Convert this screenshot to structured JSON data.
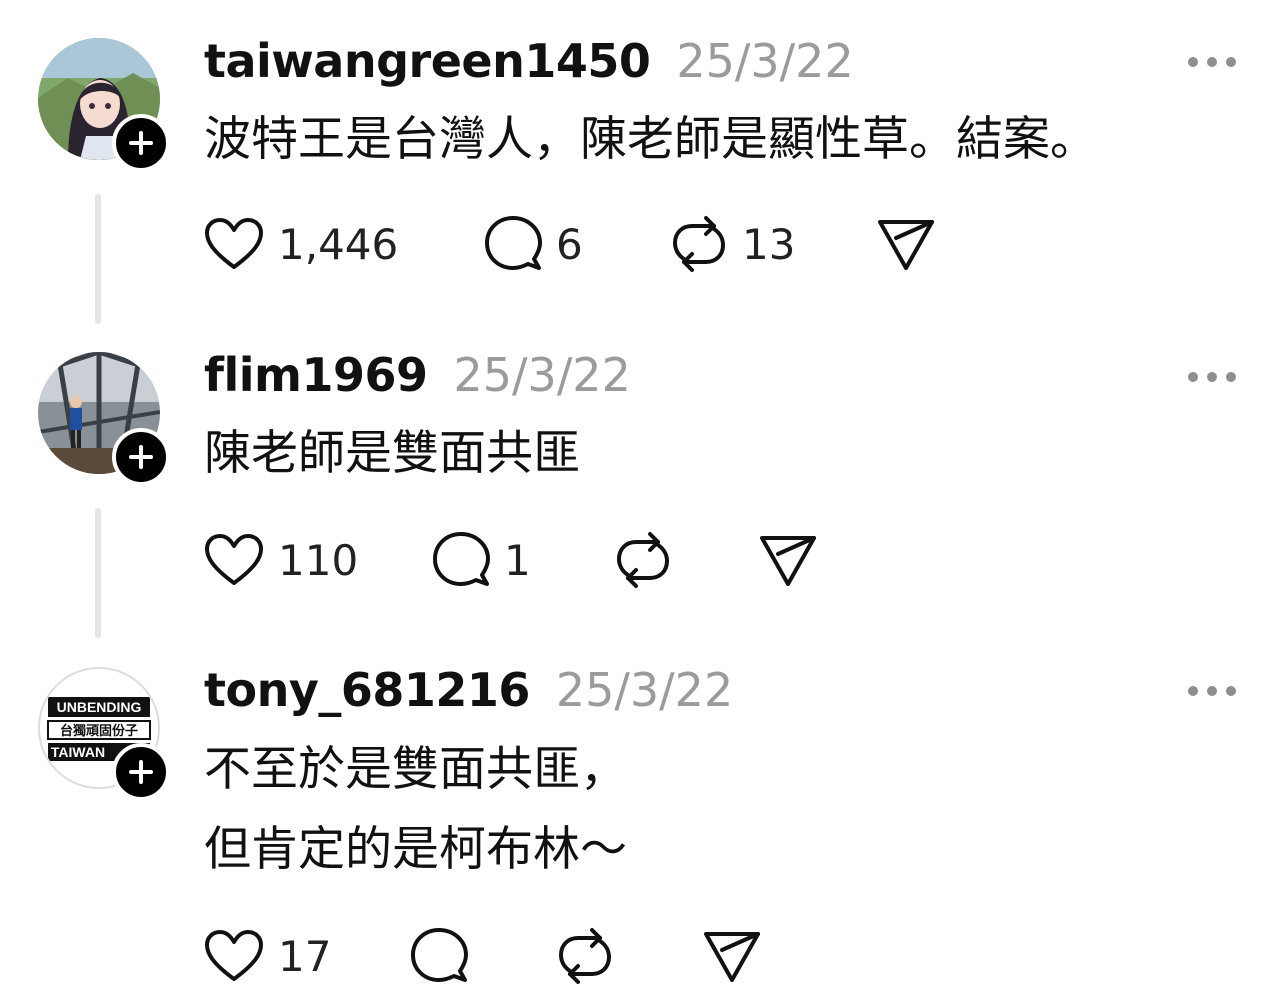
{
  "posts": [
    {
      "username": "taiwangreen1450",
      "timestamp": "25/3/22",
      "lines": [
        "波特王是台灣人，陳老師是顯性草。結案。"
      ],
      "likes": "1,446",
      "replies": "6",
      "reposts": "13"
    },
    {
      "username": "flim1969",
      "timestamp": "25/3/22",
      "lines": [
        "陳老師是雙面共匪"
      ],
      "likes": "110",
      "replies": "1",
      "reposts": ""
    },
    {
      "username": "tony_681216",
      "timestamp": "25/3/22",
      "lines": [
        "不至於是雙面共匪，",
        "但肯定的是柯布林～"
      ],
      "likes": "17",
      "replies": "",
      "reposts": "",
      "avatar_text": [
        "UNBENDING",
        "台獨頑固份子",
        "TAIWAN"
      ]
    }
  ]
}
